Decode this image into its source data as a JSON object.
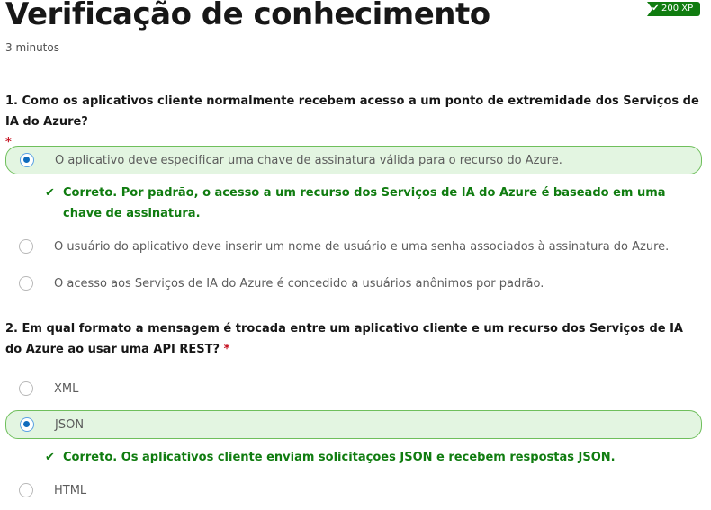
{
  "header": {
    "title": "Verificação de conhecimento",
    "duration": "3 minutos",
    "xp_badge": "200 XP",
    "badge_icon": "checkmark-icon",
    "badge_color": "#107c10"
  },
  "questions": [
    {
      "text": "1. Como os aplicativos cliente normalmente recebem acesso a um ponto de extremidade dos Serviços de IA do Azure?",
      "required_mark": "*",
      "options": [
        {
          "label": "O aplicativo deve especificar uma chave de assinatura válida para o recurso do Azure.",
          "selected": true
        },
        {
          "label": "O usuário do aplicativo deve inserir um nome de usuário e uma senha associados à assinatura do Azure.",
          "selected": false
        },
        {
          "label": "O acesso aos Serviços de IA do Azure é concedido a usuários anônimos por padrão.",
          "selected": false
        }
      ],
      "feedback": "Correto. Por padrão, o acesso a um recurso dos Serviços de IA do Azure é baseado em uma chave de assinatura."
    },
    {
      "text": "2. Em qual formato a mensagem é trocada entre um aplicativo cliente e um recurso dos Serviços de IA do Azure ao usar uma API REST?",
      "required_mark": "*",
      "options": [
        {
          "label": "XML",
          "selected": false
        },
        {
          "label": "JSON",
          "selected": true
        },
        {
          "label": "HTML",
          "selected": false
        }
      ],
      "feedback": "Correto. Os aplicativos cliente enviam solicitações JSON e recebem respostas JSON."
    }
  ],
  "colors": {
    "correct": "#107c10",
    "selected_bg": "#e3f5e1",
    "selected_border": "#6fbf5c",
    "required": "#c50f1f"
  }
}
